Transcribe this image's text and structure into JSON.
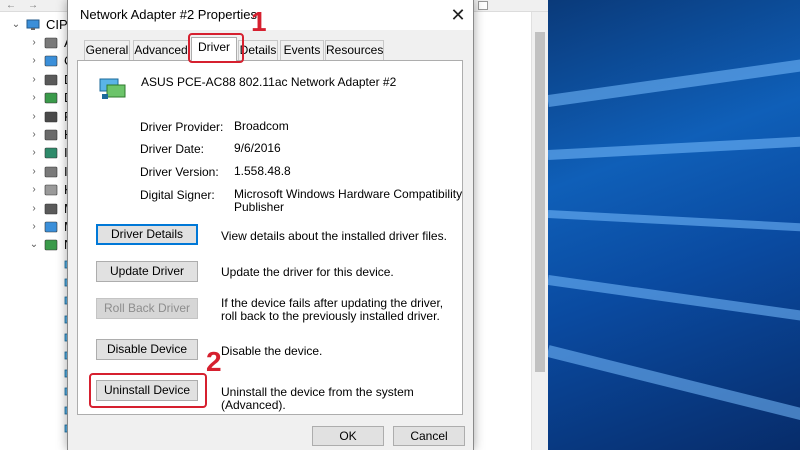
{
  "device_manager": {
    "root_label": "CIPP",
    "categories": [
      {
        "label": "A",
        "icon": "audio-icon",
        "expanded": false
      },
      {
        "label": "C",
        "icon": "computer-icon",
        "expanded": false
      },
      {
        "label": "D",
        "icon": "disk-drive-icon",
        "expanded": false
      },
      {
        "label": "D",
        "icon": "display-adapter-icon",
        "expanded": false
      },
      {
        "label": "F",
        "icon": "firmware-icon",
        "expanded": false
      },
      {
        "label": "H",
        "icon": "hid-icon",
        "expanded": false
      },
      {
        "label": "ID",
        "icon": "ide-controller-icon",
        "expanded": false
      },
      {
        "label": "In",
        "icon": "input-device-icon",
        "expanded": false
      },
      {
        "label": "K",
        "icon": "keyboard-icon",
        "expanded": false
      },
      {
        "label": "M",
        "icon": "mouse-icon",
        "expanded": false
      },
      {
        "label": "M",
        "icon": "monitor-icon",
        "expanded": false
      },
      {
        "label": "N",
        "icon": "network-adapter-icon",
        "expanded": true
      }
    ],
    "network_children_count": 10
  },
  "dialog": {
    "title": "Network Adapter #2 Properties",
    "tabs": [
      "General",
      "Advanced",
      "Driver",
      "Details",
      "Events",
      "Resources"
    ],
    "active_tab": "Driver",
    "device_name": "ASUS PCE-AC88 802.11ac Network Adapter #2",
    "properties": [
      {
        "label": "Driver Provider:",
        "value": "Broadcom"
      },
      {
        "label": "Driver Date:",
        "value": "9/6/2016"
      },
      {
        "label": "Driver Version:",
        "value": "1.558.48.8"
      },
      {
        "label": "Digital Signer:",
        "value": "Microsoft Windows Hardware Compatibility Publisher"
      }
    ],
    "actions": [
      {
        "button": "Driver Details",
        "description": "View details about the installed driver files.",
        "enabled": true
      },
      {
        "button": "Update Driver",
        "description": "Update the driver for this device.",
        "enabled": true
      },
      {
        "button": "Roll Back Driver",
        "description": "If the device fails after updating the driver, roll back to the previously installed driver.",
        "enabled": false
      },
      {
        "button": "Disable Device",
        "description": "Disable the device.",
        "enabled": true
      },
      {
        "button": "Uninstall Device",
        "description": "Uninstall the device from the system (Advanced).",
        "enabled": true
      }
    ],
    "ok_label": "OK",
    "cancel_label": "Cancel"
  },
  "annotations": {
    "step_1": "1",
    "step_2": "2",
    "color": "#d6202f"
  },
  "colors": {
    "accent": "#0078d7",
    "wallpaper": "#0f5fb8"
  }
}
